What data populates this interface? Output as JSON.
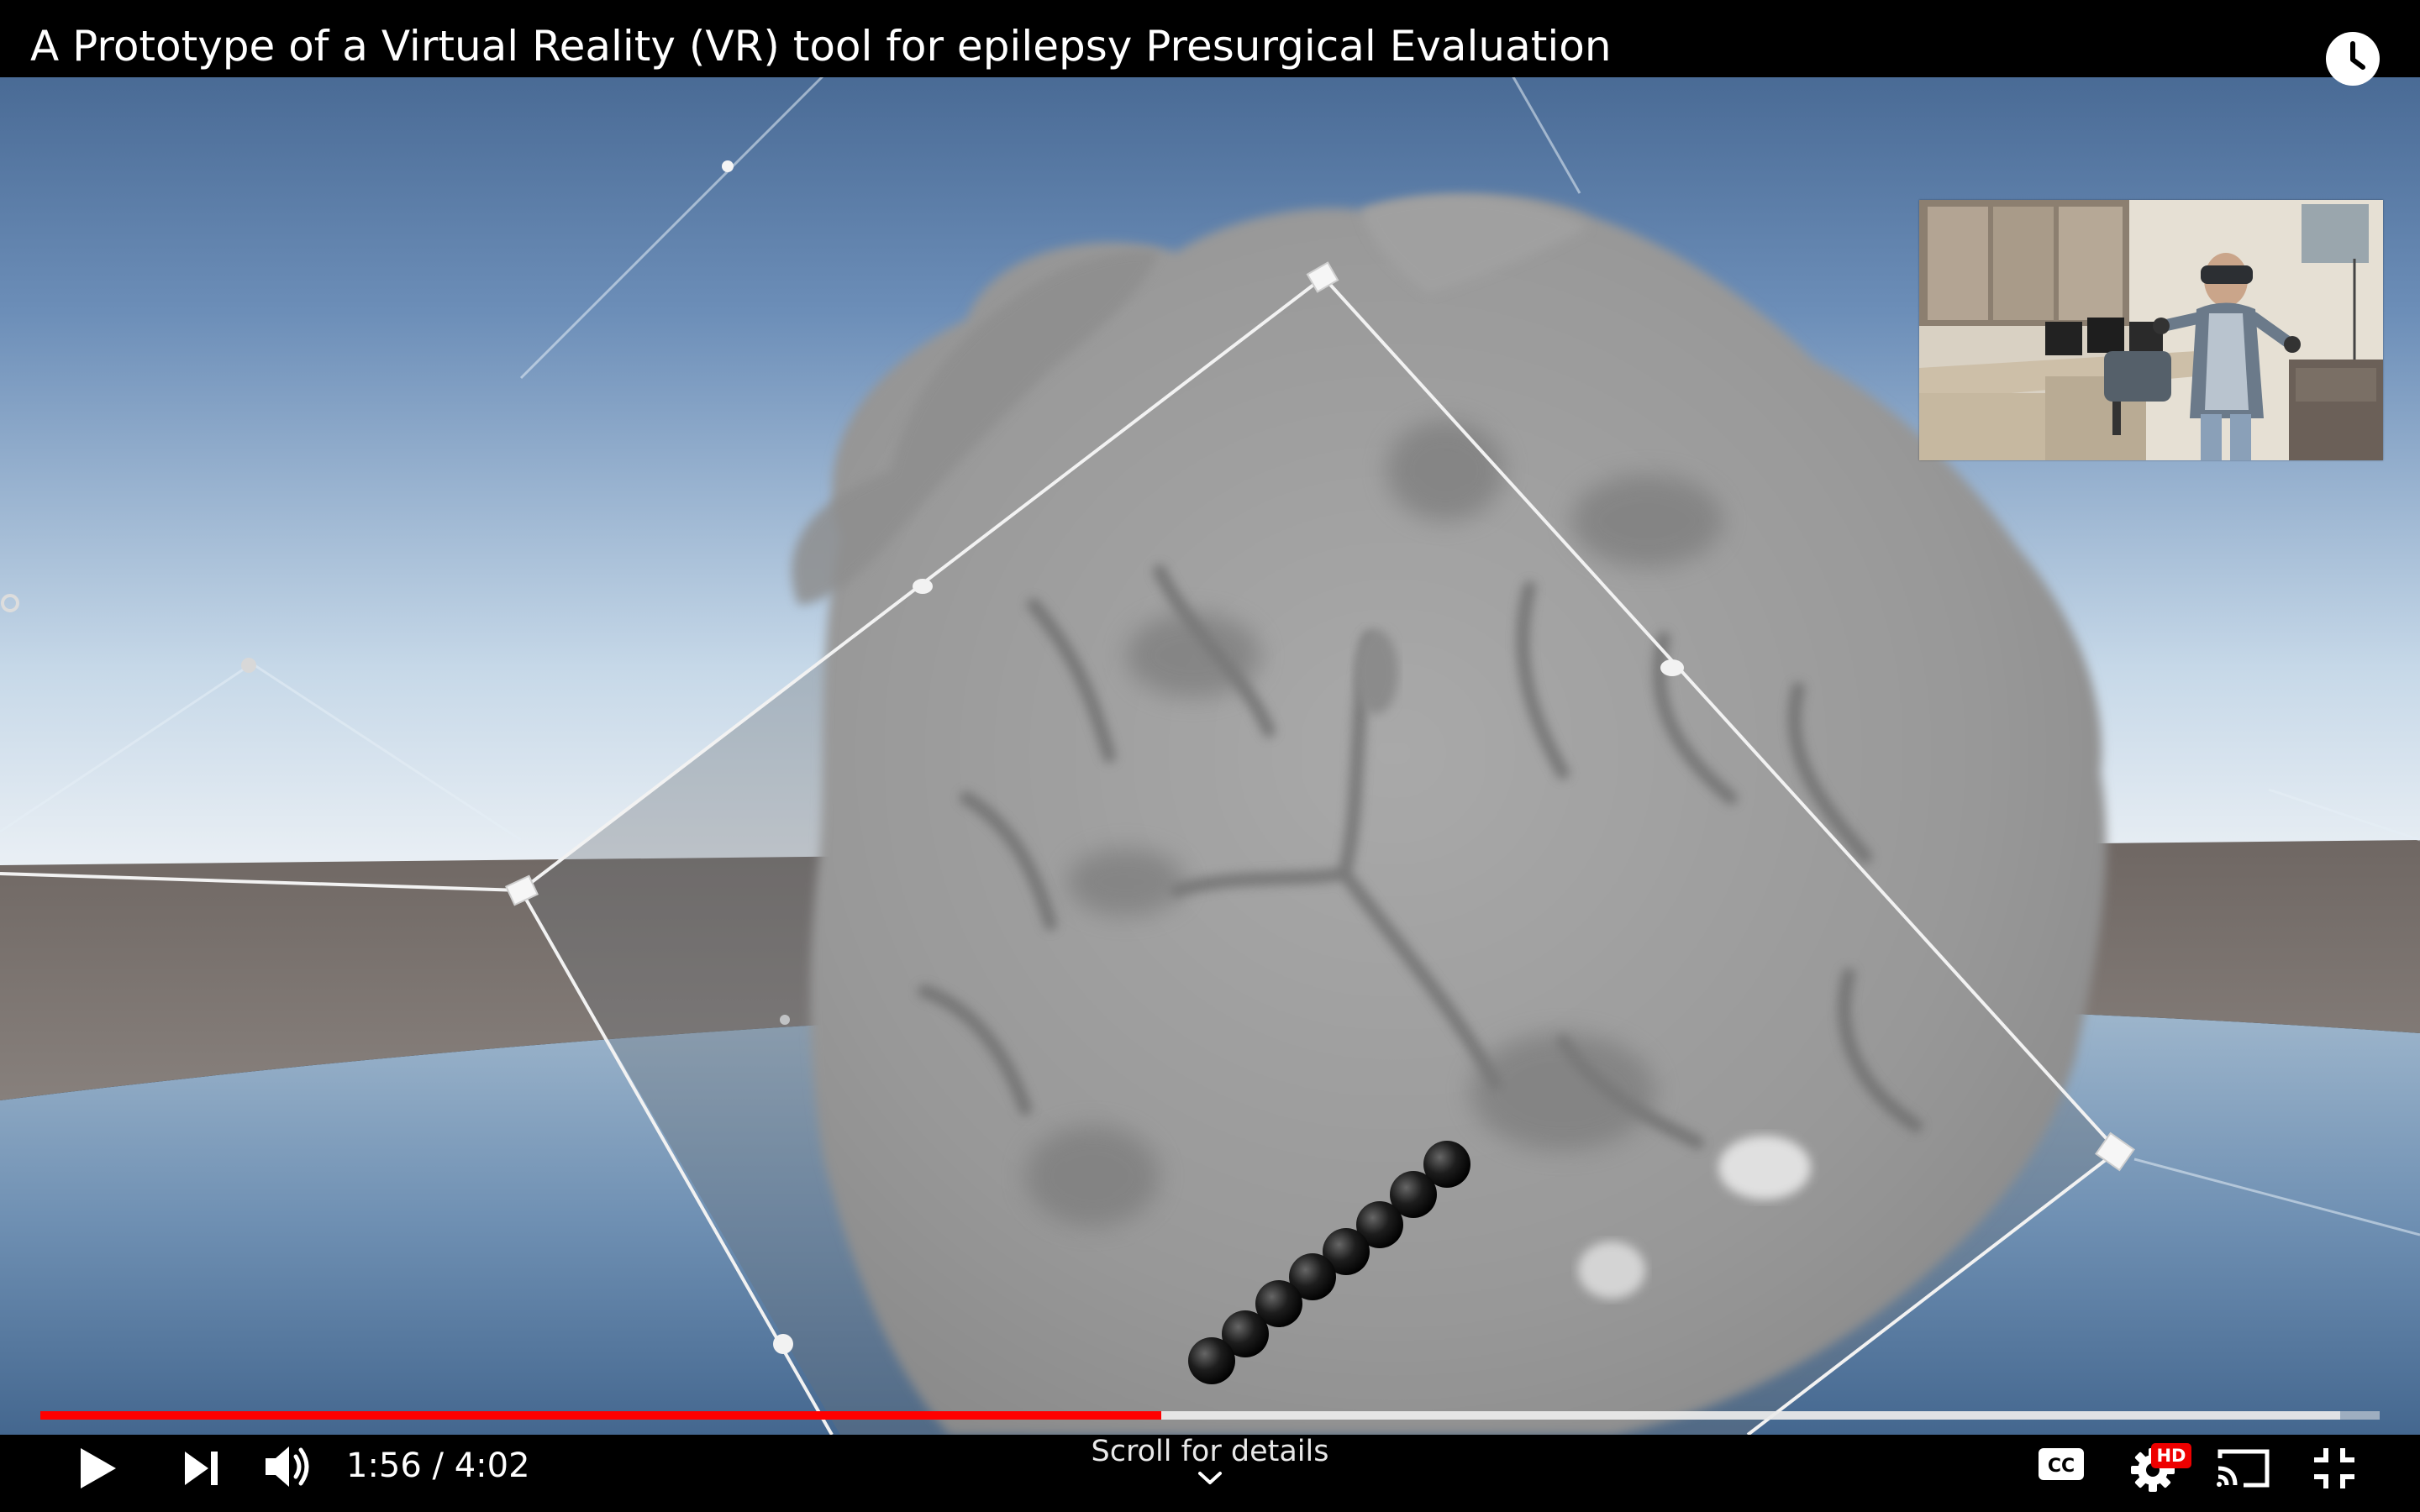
{
  "video": {
    "title": "A Prototype of a Virtual Reality (VR) tool for epilepsy Presurgical Evaluation",
    "current_time": "1:56",
    "duration": "4:02",
    "time_display": "1:56 / 4:02",
    "played_fraction": 0.479,
    "buffered_fraction": 0.983
  },
  "overlay": {
    "scroll_hint": "Scroll for details"
  },
  "controls": {
    "play_icon": "play-icon",
    "next_icon": "next-icon",
    "volume_icon": "volume-icon",
    "captions_icon": "cc-icon",
    "captions_label": "CC",
    "settings_icon": "gear-icon",
    "hd_badge": "HD",
    "cast_icon": "cast-icon",
    "fullscreen_icon": "exit-fullscreen-icon",
    "watch_later_icon": "clock-icon"
  },
  "colors": {
    "progress_played": "#ff0000",
    "bar_background": "#000000",
    "hd_badge": "#ee0000"
  }
}
